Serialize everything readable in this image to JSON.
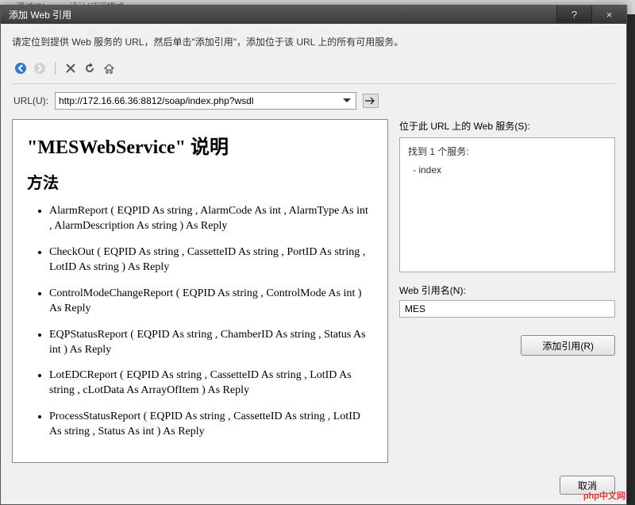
{
  "backdrop": {
    "menu1": "调试(D)",
    "menu2": "设计/订阅模式"
  },
  "dialog": {
    "title": "添加 Web 引用",
    "hint": "请定位到提供 Web 服务的 URL，然后单击\"添加引用\"，添加位于该 URL 上的所有可用服务。",
    "help_glyph": "?",
    "close_glyph": "×",
    "url_label": "URL(U):",
    "url_value": "http://172.16.66.36:8812/soap/index.php?wsdl",
    "services_label": "位于此 URL 上的 Web 服务(S):",
    "services_found": "找到 1 个服务:",
    "services_list": [
      "- index"
    ],
    "ref_name_label": "Web 引用名(N):",
    "ref_name_value": "MES",
    "add_ref_btn": "添加引用(R)",
    "cancel_btn": "取消"
  },
  "doc": {
    "title": "\"MESWebService\" 说明",
    "section": "方法",
    "methods": [
      "AlarmReport ( EQPID As string ,  AlarmCode As int ,  AlarmType As int ,  AlarmDescription As string ) As Reply",
      "CheckOut ( EQPID As string ,  CassetteID As string ,  PortID As string ,  LotID As string ) As Reply",
      "ControlModeChangeReport ( EQPID As string ,  ControlMode As int ) As Reply",
      "EQPStatusReport ( EQPID As string ,  ChamberID As string ,  Status As int ) As Reply",
      "LotEDCReport ( EQPID As string ,  CassetteID As string ,  LotID As string ,  cLotData As ArrayOfItem ) As Reply",
      "ProcessStatusReport ( EQPID As string ,  CassetteID As string ,  LotID As string ,  Status As int ) As Reply"
    ]
  },
  "watermark": "php中文网"
}
